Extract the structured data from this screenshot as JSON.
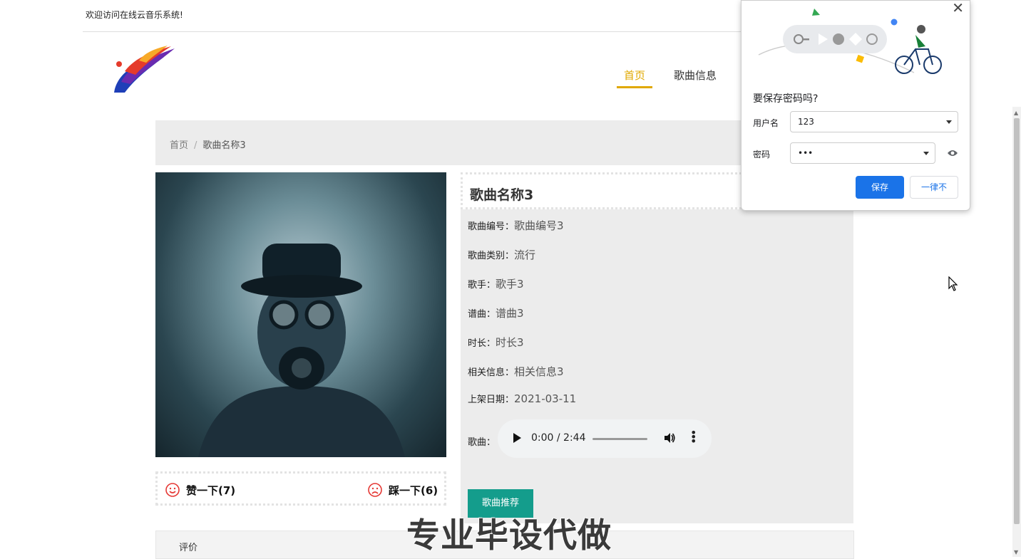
{
  "header": {
    "welcome": "欢迎访问在线云音乐系统!",
    "nav": {
      "home": "首页",
      "songs": "歌曲信息"
    }
  },
  "breadcrumb": {
    "home": "首页",
    "sep": "/",
    "current": "歌曲名称3"
  },
  "song": {
    "title": "歌曲名称3",
    "fields": [
      {
        "label": "歌曲编号：",
        "value": "歌曲编号3"
      },
      {
        "label": "歌曲类别：",
        "value": "流行"
      },
      {
        "label": "歌手：",
        "value": "歌手3"
      },
      {
        "label": "谱曲：",
        "value": "谱曲3"
      },
      {
        "label": "时长：",
        "value": "时长3"
      },
      {
        "label": "相关信息：",
        "value": "相关信息3"
      },
      {
        "label": "上架日期：",
        "value": "2021-03-11"
      }
    ],
    "audio_label": "歌曲：",
    "audio_time": "0:00 / 2:44",
    "recommend_button": "歌曲推荐"
  },
  "votes": {
    "like": "赞一下(7)",
    "dislike": "踩一下(6)"
  },
  "review": {
    "label": "评价"
  },
  "watermark": "专业毕设代做",
  "password_popup": {
    "close": "✕",
    "title": "要保存密码吗?",
    "username_label": "用户名",
    "username_value": "123",
    "password_label": "密码",
    "password_value": "•••",
    "save_button": "保存",
    "never_button": "一律不"
  },
  "colors": {
    "accent": "#e0a800",
    "teal": "#149d8c",
    "chrome_blue": "#1a73e8"
  }
}
